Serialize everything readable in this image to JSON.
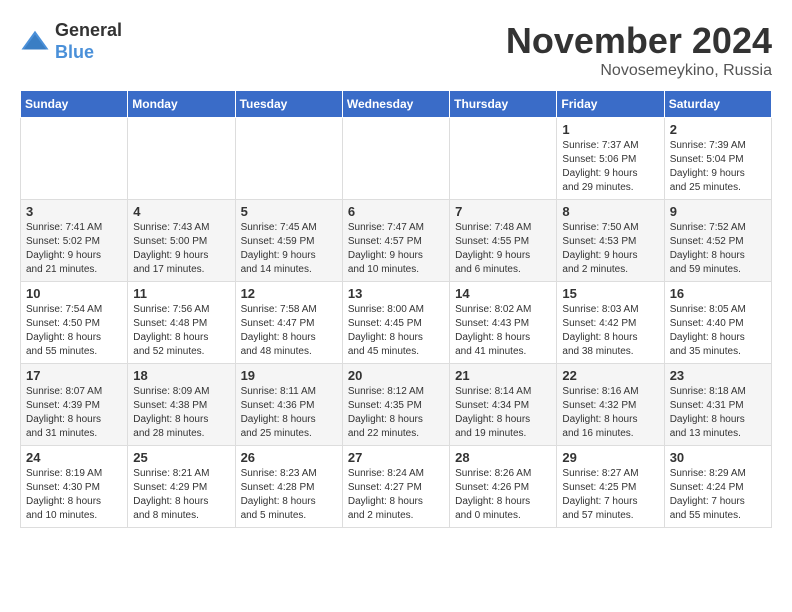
{
  "header": {
    "logo_general": "General",
    "logo_blue": "Blue",
    "month_title": "November 2024",
    "location": "Novosemeykino, Russia"
  },
  "weekdays": [
    "Sunday",
    "Monday",
    "Tuesday",
    "Wednesday",
    "Thursday",
    "Friday",
    "Saturday"
  ],
  "weeks": [
    [
      {
        "day": "",
        "info": ""
      },
      {
        "day": "",
        "info": ""
      },
      {
        "day": "",
        "info": ""
      },
      {
        "day": "",
        "info": ""
      },
      {
        "day": "",
        "info": ""
      },
      {
        "day": "1",
        "info": "Sunrise: 7:37 AM\nSunset: 5:06 PM\nDaylight: 9 hours\nand 29 minutes."
      },
      {
        "day": "2",
        "info": "Sunrise: 7:39 AM\nSunset: 5:04 PM\nDaylight: 9 hours\nand 25 minutes."
      }
    ],
    [
      {
        "day": "3",
        "info": "Sunrise: 7:41 AM\nSunset: 5:02 PM\nDaylight: 9 hours\nand 21 minutes."
      },
      {
        "day": "4",
        "info": "Sunrise: 7:43 AM\nSunset: 5:00 PM\nDaylight: 9 hours\nand 17 minutes."
      },
      {
        "day": "5",
        "info": "Sunrise: 7:45 AM\nSunset: 4:59 PM\nDaylight: 9 hours\nand 14 minutes."
      },
      {
        "day": "6",
        "info": "Sunrise: 7:47 AM\nSunset: 4:57 PM\nDaylight: 9 hours\nand 10 minutes."
      },
      {
        "day": "7",
        "info": "Sunrise: 7:48 AM\nSunset: 4:55 PM\nDaylight: 9 hours\nand 6 minutes."
      },
      {
        "day": "8",
        "info": "Sunrise: 7:50 AM\nSunset: 4:53 PM\nDaylight: 9 hours\nand 2 minutes."
      },
      {
        "day": "9",
        "info": "Sunrise: 7:52 AM\nSunset: 4:52 PM\nDaylight: 8 hours\nand 59 minutes."
      }
    ],
    [
      {
        "day": "10",
        "info": "Sunrise: 7:54 AM\nSunset: 4:50 PM\nDaylight: 8 hours\nand 55 minutes."
      },
      {
        "day": "11",
        "info": "Sunrise: 7:56 AM\nSunset: 4:48 PM\nDaylight: 8 hours\nand 52 minutes."
      },
      {
        "day": "12",
        "info": "Sunrise: 7:58 AM\nSunset: 4:47 PM\nDaylight: 8 hours\nand 48 minutes."
      },
      {
        "day": "13",
        "info": "Sunrise: 8:00 AM\nSunset: 4:45 PM\nDaylight: 8 hours\nand 45 minutes."
      },
      {
        "day": "14",
        "info": "Sunrise: 8:02 AM\nSunset: 4:43 PM\nDaylight: 8 hours\nand 41 minutes."
      },
      {
        "day": "15",
        "info": "Sunrise: 8:03 AM\nSunset: 4:42 PM\nDaylight: 8 hours\nand 38 minutes."
      },
      {
        "day": "16",
        "info": "Sunrise: 8:05 AM\nSunset: 4:40 PM\nDaylight: 8 hours\nand 35 minutes."
      }
    ],
    [
      {
        "day": "17",
        "info": "Sunrise: 8:07 AM\nSunset: 4:39 PM\nDaylight: 8 hours\nand 31 minutes."
      },
      {
        "day": "18",
        "info": "Sunrise: 8:09 AM\nSunset: 4:38 PM\nDaylight: 8 hours\nand 28 minutes."
      },
      {
        "day": "19",
        "info": "Sunrise: 8:11 AM\nSunset: 4:36 PM\nDaylight: 8 hours\nand 25 minutes."
      },
      {
        "day": "20",
        "info": "Sunrise: 8:12 AM\nSunset: 4:35 PM\nDaylight: 8 hours\nand 22 minutes."
      },
      {
        "day": "21",
        "info": "Sunrise: 8:14 AM\nSunset: 4:34 PM\nDaylight: 8 hours\nand 19 minutes."
      },
      {
        "day": "22",
        "info": "Sunrise: 8:16 AM\nSunset: 4:32 PM\nDaylight: 8 hours\nand 16 minutes."
      },
      {
        "day": "23",
        "info": "Sunrise: 8:18 AM\nSunset: 4:31 PM\nDaylight: 8 hours\nand 13 minutes."
      }
    ],
    [
      {
        "day": "24",
        "info": "Sunrise: 8:19 AM\nSunset: 4:30 PM\nDaylight: 8 hours\nand 10 minutes."
      },
      {
        "day": "25",
        "info": "Sunrise: 8:21 AM\nSunset: 4:29 PM\nDaylight: 8 hours\nand 8 minutes."
      },
      {
        "day": "26",
        "info": "Sunrise: 8:23 AM\nSunset: 4:28 PM\nDaylight: 8 hours\nand 5 minutes."
      },
      {
        "day": "27",
        "info": "Sunrise: 8:24 AM\nSunset: 4:27 PM\nDaylight: 8 hours\nand 2 minutes."
      },
      {
        "day": "28",
        "info": "Sunrise: 8:26 AM\nSunset: 4:26 PM\nDaylight: 8 hours\nand 0 minutes."
      },
      {
        "day": "29",
        "info": "Sunrise: 8:27 AM\nSunset: 4:25 PM\nDaylight: 7 hours\nand 57 minutes."
      },
      {
        "day": "30",
        "info": "Sunrise: 8:29 AM\nSunset: 4:24 PM\nDaylight: 7 hours\nand 55 minutes."
      }
    ]
  ]
}
